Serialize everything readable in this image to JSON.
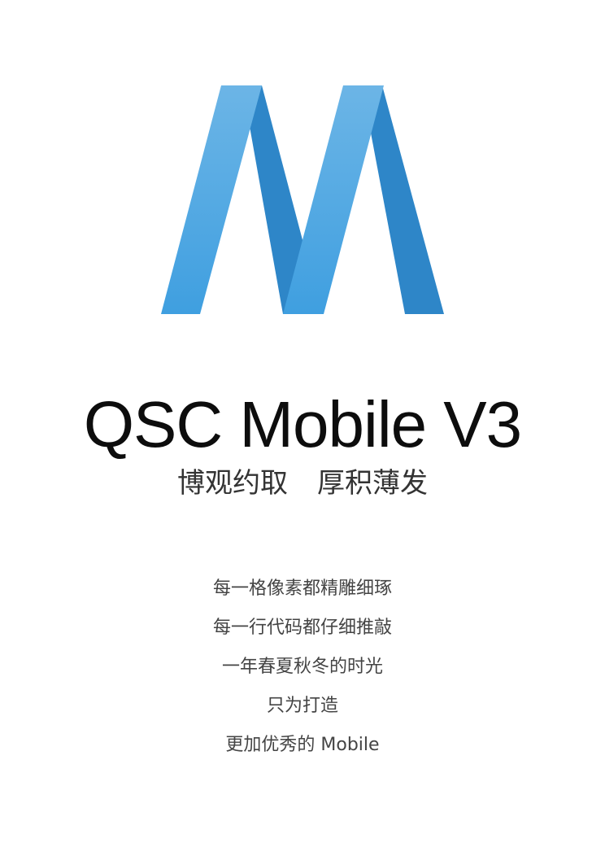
{
  "logo": {
    "name": "QSC Mobile logo",
    "colors": {
      "light_top": "#6cb5e6",
      "light_bottom": "#3f9fe0",
      "dark": "#2e86c8"
    }
  },
  "title": "QSC Mobile V3",
  "slogan": {
    "part1": "博观约取",
    "part2": "厚积薄发"
  },
  "lines": [
    "每一格像素都精雕细琢",
    "每一行代码都仔细推敲",
    "一年春夏秋冬的时光",
    "只为打造",
    "更加优秀的 Mobile"
  ]
}
